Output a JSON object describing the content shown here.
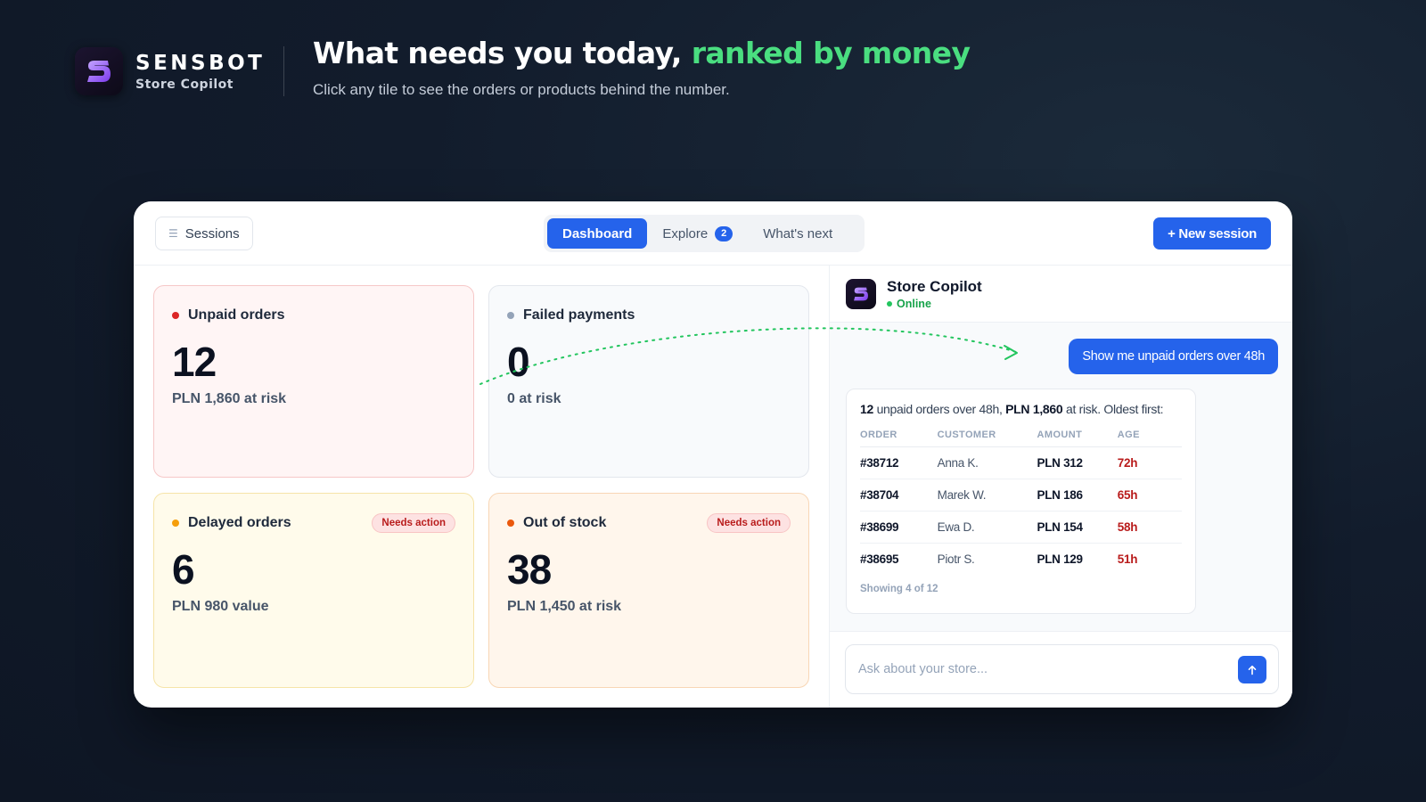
{
  "brand": {
    "name": "SENSBOT",
    "subtitle": "Store Copilot"
  },
  "headline": {
    "main": "What needs you today, ",
    "accent": "ranked by money",
    "sub": "Click any tile to see the orders or products behind the number."
  },
  "colors": {
    "accent_green": "#4ade80",
    "primary_blue": "#2563eb",
    "danger_red": "#b91c1c"
  },
  "toolbar": {
    "sessions_label": "Sessions",
    "tabs": [
      {
        "label": "Dashboard",
        "active": true
      },
      {
        "label": "Explore",
        "badge": "2"
      },
      {
        "label": "What's next"
      }
    ],
    "new_session_label": "+ New session"
  },
  "tiles": [
    {
      "label": "Unpaid orders",
      "value": "12",
      "sub": "PLN 1,860 at risk",
      "dot_color": "#dc2626"
    },
    {
      "label": "Failed payments",
      "value": "0",
      "sub": "0 at risk",
      "dot_color": "#94a3b8"
    },
    {
      "label": "Delayed orders",
      "value": "6",
      "sub": "PLN 980 value",
      "badge": "Needs action",
      "dot_color": "#f59e0b"
    },
    {
      "label": "Out of stock",
      "value": "38",
      "sub": "PLN 1,450 at risk",
      "badge": "Needs action",
      "dot_color": "#ea580c"
    }
  ],
  "chat": {
    "name": "Store Copilot",
    "status": "Online",
    "user_message": "Show me unpaid orders over 48h",
    "reply": {
      "count": "12",
      "text1": " unpaid orders over 48h, ",
      "amount": "PLN 1,860",
      "text2": " at risk. Oldest first:",
      "columns": [
        "ORDER",
        "CUSTOMER",
        "AMOUNT",
        "AGE"
      ],
      "rows": [
        {
          "order": "#38712",
          "customer": "Anna K.",
          "amount": "PLN 312",
          "age": "72h"
        },
        {
          "order": "#38704",
          "customer": "Marek W.",
          "amount": "PLN 186",
          "age": "65h"
        },
        {
          "order": "#38699",
          "customer": "Ewa D.",
          "amount": "PLN 154",
          "age": "58h"
        },
        {
          "order": "#38695",
          "customer": "Piotr S.",
          "amount": "PLN 129",
          "age": "51h"
        }
      ],
      "showing": "Showing 4 of 12"
    },
    "input_placeholder": "Ask about your store..."
  }
}
